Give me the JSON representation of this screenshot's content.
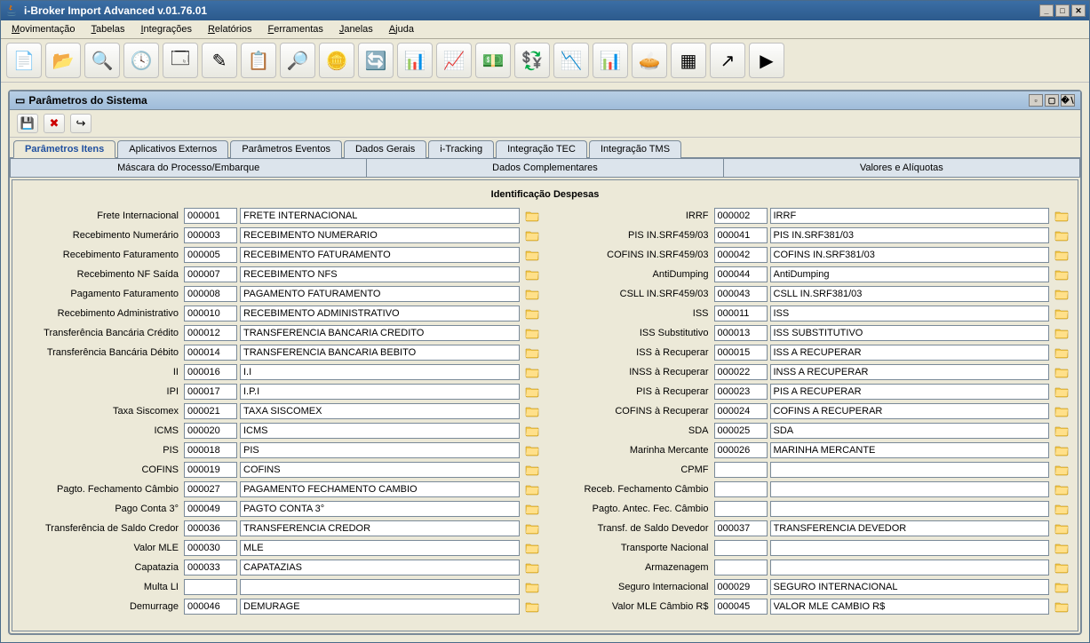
{
  "window": {
    "title": "i-Broker Import Advanced v.01.76.01"
  },
  "menubar": [
    "Movimentação",
    "Tabelas",
    "Integrações",
    "Relatórios",
    "Ferramentas",
    "Janelas",
    "Ajuda"
  ],
  "toolbar_icons": [
    "document-new-icon",
    "folder-open-icon",
    "folder-search-icon",
    "folder-time-icon",
    "window-icon",
    "edit-icon",
    "list-icon",
    "search-icon",
    "coins-icon",
    "refresh-icon",
    "report-icon",
    "sheet-icon",
    "money-icon",
    "money-sync-icon",
    "chart-pie-icon",
    "chart-bar-icon",
    "pie-icon",
    "grid-icon",
    "arrow-icon",
    "play-icon"
  ],
  "internal": {
    "title": "Parâmetros do Sistema"
  },
  "mini_toolbar": [
    {
      "name": "save-icon",
      "glyph": "💾"
    },
    {
      "name": "delete-icon",
      "glyph": "✖"
    },
    {
      "name": "exit-icon",
      "glyph": "↪"
    }
  ],
  "tabs": [
    "Parâmetros Itens",
    "Aplicativos Externos",
    "Parâmetros Eventos",
    "Dados Gerais",
    "i-Tracking",
    "Integração TEC",
    "Integração TMS"
  ],
  "active_tab": 0,
  "subtabs": [
    "Máscara do Processo/Embarque",
    "Dados Complementares",
    "Valores e Alíquotas"
  ],
  "section": "Identificação Despesas",
  "left_rows": [
    {
      "label": "Frete Internacional",
      "code": "000001",
      "desc": "FRETE INTERNACIONAL"
    },
    {
      "label": "Recebimento Numerário",
      "code": "000003",
      "desc": "RECEBIMENTO NUMERARIO"
    },
    {
      "label": "Recebimento Faturamento",
      "code": "000005",
      "desc": "RECEBIMENTO FATURAMENTO"
    },
    {
      "label": "Recebimento NF Saída",
      "code": "000007",
      "desc": "RECEBIMENTO NFS"
    },
    {
      "label": "Pagamento Faturamento",
      "code": "000008",
      "desc": "PAGAMENTO FATURAMENTO"
    },
    {
      "label": "Recebimento Administrativo",
      "code": "000010",
      "desc": "RECEBIMENTO ADMINISTRATIVO"
    },
    {
      "label": "Transferência Bancária Crédito",
      "code": "000012",
      "desc": "TRANSFERENCIA BANCARIA CREDITO"
    },
    {
      "label": "Transferência Bancária Débito",
      "code": "000014",
      "desc": "TRANSFERENCIA BANCARIA BEBITO"
    },
    {
      "label": "II",
      "code": "000016",
      "desc": "I.I"
    },
    {
      "label": "IPI",
      "code": "000017",
      "desc": "I.P.I"
    },
    {
      "label": "Taxa Siscomex",
      "code": "000021",
      "desc": "TAXA SISCOMEX"
    },
    {
      "label": "ICMS",
      "code": "000020",
      "desc": "ICMS"
    },
    {
      "label": "PIS",
      "code": "000018",
      "desc": "PIS"
    },
    {
      "label": "COFINS",
      "code": "000019",
      "desc": "COFINS"
    },
    {
      "label": "Pagto. Fechamento Câmbio",
      "code": "000027",
      "desc": "PAGAMENTO FECHAMENTO CAMBIO"
    },
    {
      "label": "Pago Conta 3°",
      "code": "000049",
      "desc": "PAGTO CONTA 3°"
    },
    {
      "label": "Transferência de Saldo Credor",
      "code": "000036",
      "desc": "TRANSFERENCIA CREDOR"
    },
    {
      "label": "Valor MLE",
      "code": "000030",
      "desc": "MLE"
    },
    {
      "label": "Capatazia",
      "code": "000033",
      "desc": "CAPATAZIAS"
    },
    {
      "label": "Multa LI",
      "code": "",
      "desc": ""
    },
    {
      "label": "Demurrage",
      "code": "000046",
      "desc": "DEMURAGE"
    }
  ],
  "right_rows": [
    {
      "label": "IRRF",
      "code": "000002",
      "desc": "IRRF"
    },
    {
      "label": "PIS IN.SRF459/03",
      "code": "000041",
      "desc": "PIS IN.SRF381/03"
    },
    {
      "label": "COFINS IN.SRF459/03",
      "code": "000042",
      "desc": "COFINS IN.SRF381/03"
    },
    {
      "label": "AntiDumping",
      "code": "000044",
      "desc": "AntiDumping"
    },
    {
      "label": "CSLL IN.SRF459/03",
      "code": "000043",
      "desc": "CSLL IN.SRF381/03"
    },
    {
      "label": "ISS",
      "code": "000011",
      "desc": "ISS"
    },
    {
      "label": "ISS Substitutivo",
      "code": "000013",
      "desc": "ISS SUBSTITUTIVO"
    },
    {
      "label": "ISS à Recuperar",
      "code": "000015",
      "desc": "ISS A RECUPERAR"
    },
    {
      "label": "INSS à Recuperar",
      "code": "000022",
      "desc": "INSS A RECUPERAR"
    },
    {
      "label": "PIS à Recuperar",
      "code": "000023",
      "desc": "PIS A RECUPERAR"
    },
    {
      "label": "COFINS à Recuperar",
      "code": "000024",
      "desc": "COFINS A RECUPERAR"
    },
    {
      "label": "SDA",
      "code": "000025",
      "desc": "SDA"
    },
    {
      "label": "Marinha Mercante",
      "code": "000026",
      "desc": "MARINHA MERCANTE"
    },
    {
      "label": "CPMF",
      "code": "",
      "desc": ""
    },
    {
      "label": "Receb. Fechamento Câmbio",
      "code": "",
      "desc": ""
    },
    {
      "label": "Pagto. Antec. Fec. Câmbio",
      "code": "",
      "desc": ""
    },
    {
      "label": "Transf. de Saldo Devedor",
      "code": "000037",
      "desc": "TRANSFERENCIA DEVEDOR"
    },
    {
      "label": "Transporte Nacional",
      "code": "",
      "desc": ""
    },
    {
      "label": "Armazenagem",
      "code": "",
      "desc": ""
    },
    {
      "label": "Seguro Internacional",
      "code": "000029",
      "desc": "SEGURO INTERNACIONAL"
    },
    {
      "label": "Valor MLE Câmbio R$",
      "code": "000045",
      "desc": "VALOR MLE CAMBIO R$"
    }
  ]
}
